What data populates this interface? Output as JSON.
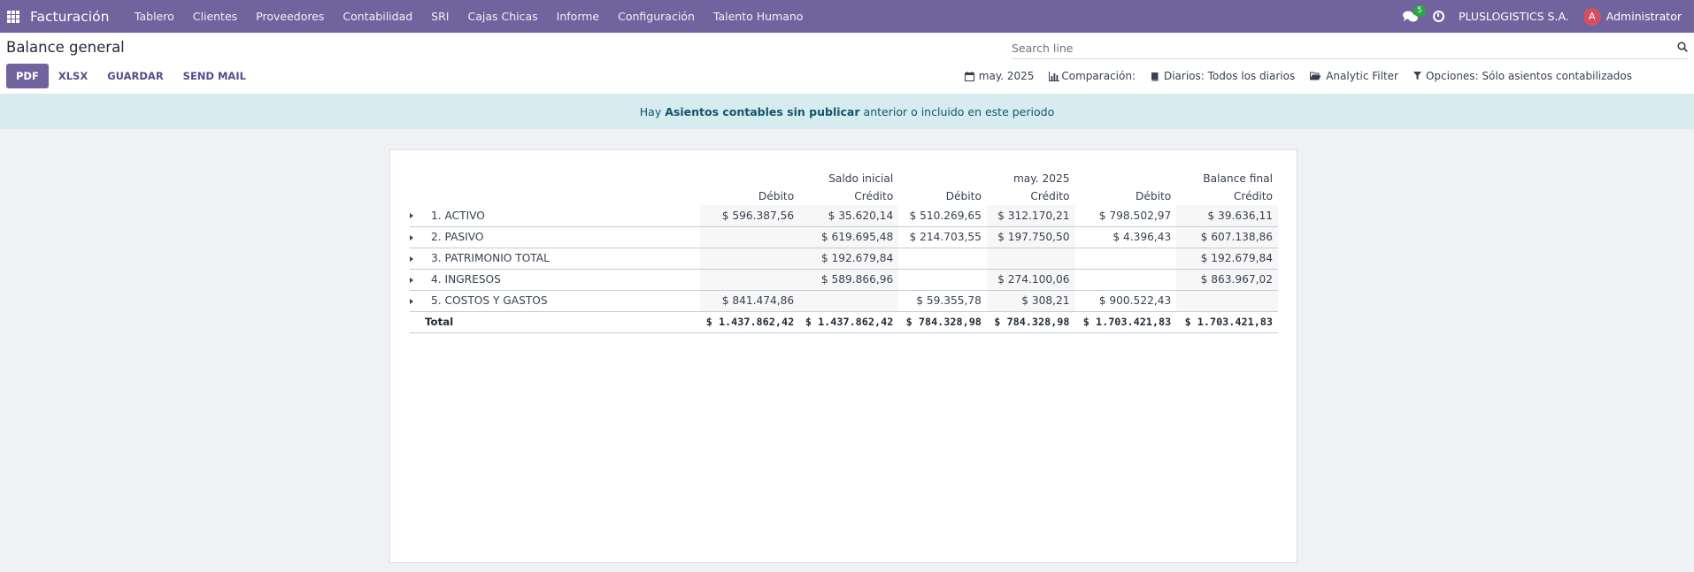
{
  "nav": {
    "brand": "Facturación",
    "menu": [
      "Tablero",
      "Clientes",
      "Proveedores",
      "Contabilidad",
      "SRI",
      "Cajas Chicas",
      "Informe",
      "Configuración",
      "Talento Humano"
    ],
    "messages_count": "5",
    "company": "PLUSLOGISTICS S.A.",
    "avatar_initial": "A",
    "user": "Administrator"
  },
  "control": {
    "title": "Balance general",
    "search_placeholder": "Search line",
    "buttons": {
      "pdf": "PDF",
      "xlsx": "XLSX",
      "save": "GUARDAR",
      "mail": "SEND MAIL"
    },
    "filters": {
      "period": "may. 2025",
      "comparison": "Comparación:",
      "journals": "Diarios: Todos los diarios",
      "analytic": "Analytic Filter",
      "options": "Opciones: Sólo asientos contabilizados"
    }
  },
  "alert": {
    "prefix": "Hay",
    "link": "Asientos contables sin publicar",
    "suffix": "anterior o incluido en este periodo"
  },
  "report": {
    "groups": [
      "Saldo inicial",
      "may. 2025",
      "Balance final"
    ],
    "columns": [
      "Débito",
      "Crédito",
      "Débito",
      "Crédito",
      "Débito",
      "Crédito"
    ],
    "rows": [
      {
        "name": "1. ACTIVO",
        "values": [
          "$ 596.387,56",
          "$ 35.620,14",
          "$ 510.269,65",
          "$ 312.170,21",
          "$ 798.502,97",
          "$ 39.636,11"
        ]
      },
      {
        "name": "2. PASIVO",
        "values": [
          "",
          "$ 619.695,48",
          "$ 214.703,55",
          "$ 197.750,50",
          "$ 4.396,43",
          "$ 607.138,86"
        ]
      },
      {
        "name": "3. PATRIMONIO TOTAL",
        "values": [
          "",
          "$ 192.679,84",
          "",
          "",
          "",
          "$ 192.679,84"
        ]
      },
      {
        "name": "4. INGRESOS",
        "values": [
          "",
          "$ 589.866,96",
          "",
          "$ 274.100,06",
          "",
          "$ 863.967,02"
        ]
      },
      {
        "name": "5. COSTOS Y GASTOS",
        "values": [
          "$ 841.474,86",
          "",
          "$ 59.355,78",
          "$ 308,21",
          "$ 900.522,43",
          ""
        ]
      }
    ],
    "total": {
      "name": "Total",
      "values": [
        "$ 1.437.862,42",
        "$ 1.437.862,42",
        "$ 784.328,98",
        "$ 784.328,98",
        "$ 1.703.421,83",
        "$ 1.703.421,83"
      ]
    }
  }
}
